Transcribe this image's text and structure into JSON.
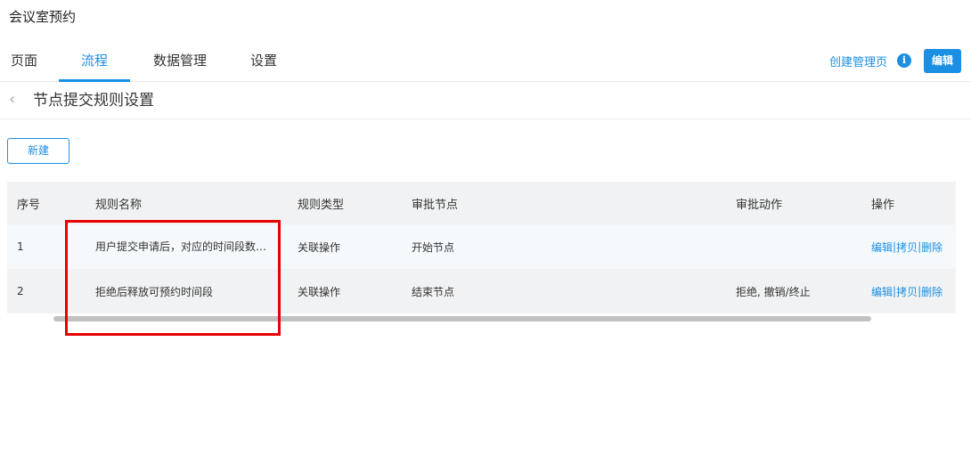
{
  "app": {
    "title": "会议室预约"
  },
  "tabs": [
    {
      "label": "页面",
      "active": false
    },
    {
      "label": "流程",
      "active": true
    },
    {
      "label": "数据管理",
      "active": false
    },
    {
      "label": "设置",
      "active": false
    }
  ],
  "header_actions": {
    "create_page_label": "创建管理页",
    "info_icon": "info-icon",
    "edit_label": "编辑"
  },
  "sub_header": {
    "back_icon": "chevron-left-icon",
    "title": "节点提交规则设置"
  },
  "toolbar": {
    "new_label": "新建"
  },
  "table": {
    "columns": [
      "序号",
      "规则名称",
      "规则类型",
      "审批节点",
      "审批动作",
      "操作"
    ],
    "rows": [
      {
        "index": "1",
        "name": "用户提交申请后，对应的时间段数据占用",
        "type": "关联操作",
        "node": "开始节点",
        "action": "",
        "ops": {
          "edit": "编辑",
          "sep1": "|",
          "copy": "拷贝",
          "sep2": "|",
          "delete": "删除"
        }
      },
      {
        "index": "2",
        "name": "拒绝后释放可预约时间段",
        "type": "关联操作",
        "node": "结束节点",
        "action": "拒绝, 撤销/终止",
        "ops": {
          "edit": "编辑",
          "sep1": "|",
          "copy": "拷贝",
          "sep2": "|",
          "delete": "删除"
        }
      }
    ]
  },
  "colors": {
    "accent": "#1a8fe3",
    "highlight": "#e60000",
    "table_header_bg": "#f1f2f3"
  }
}
